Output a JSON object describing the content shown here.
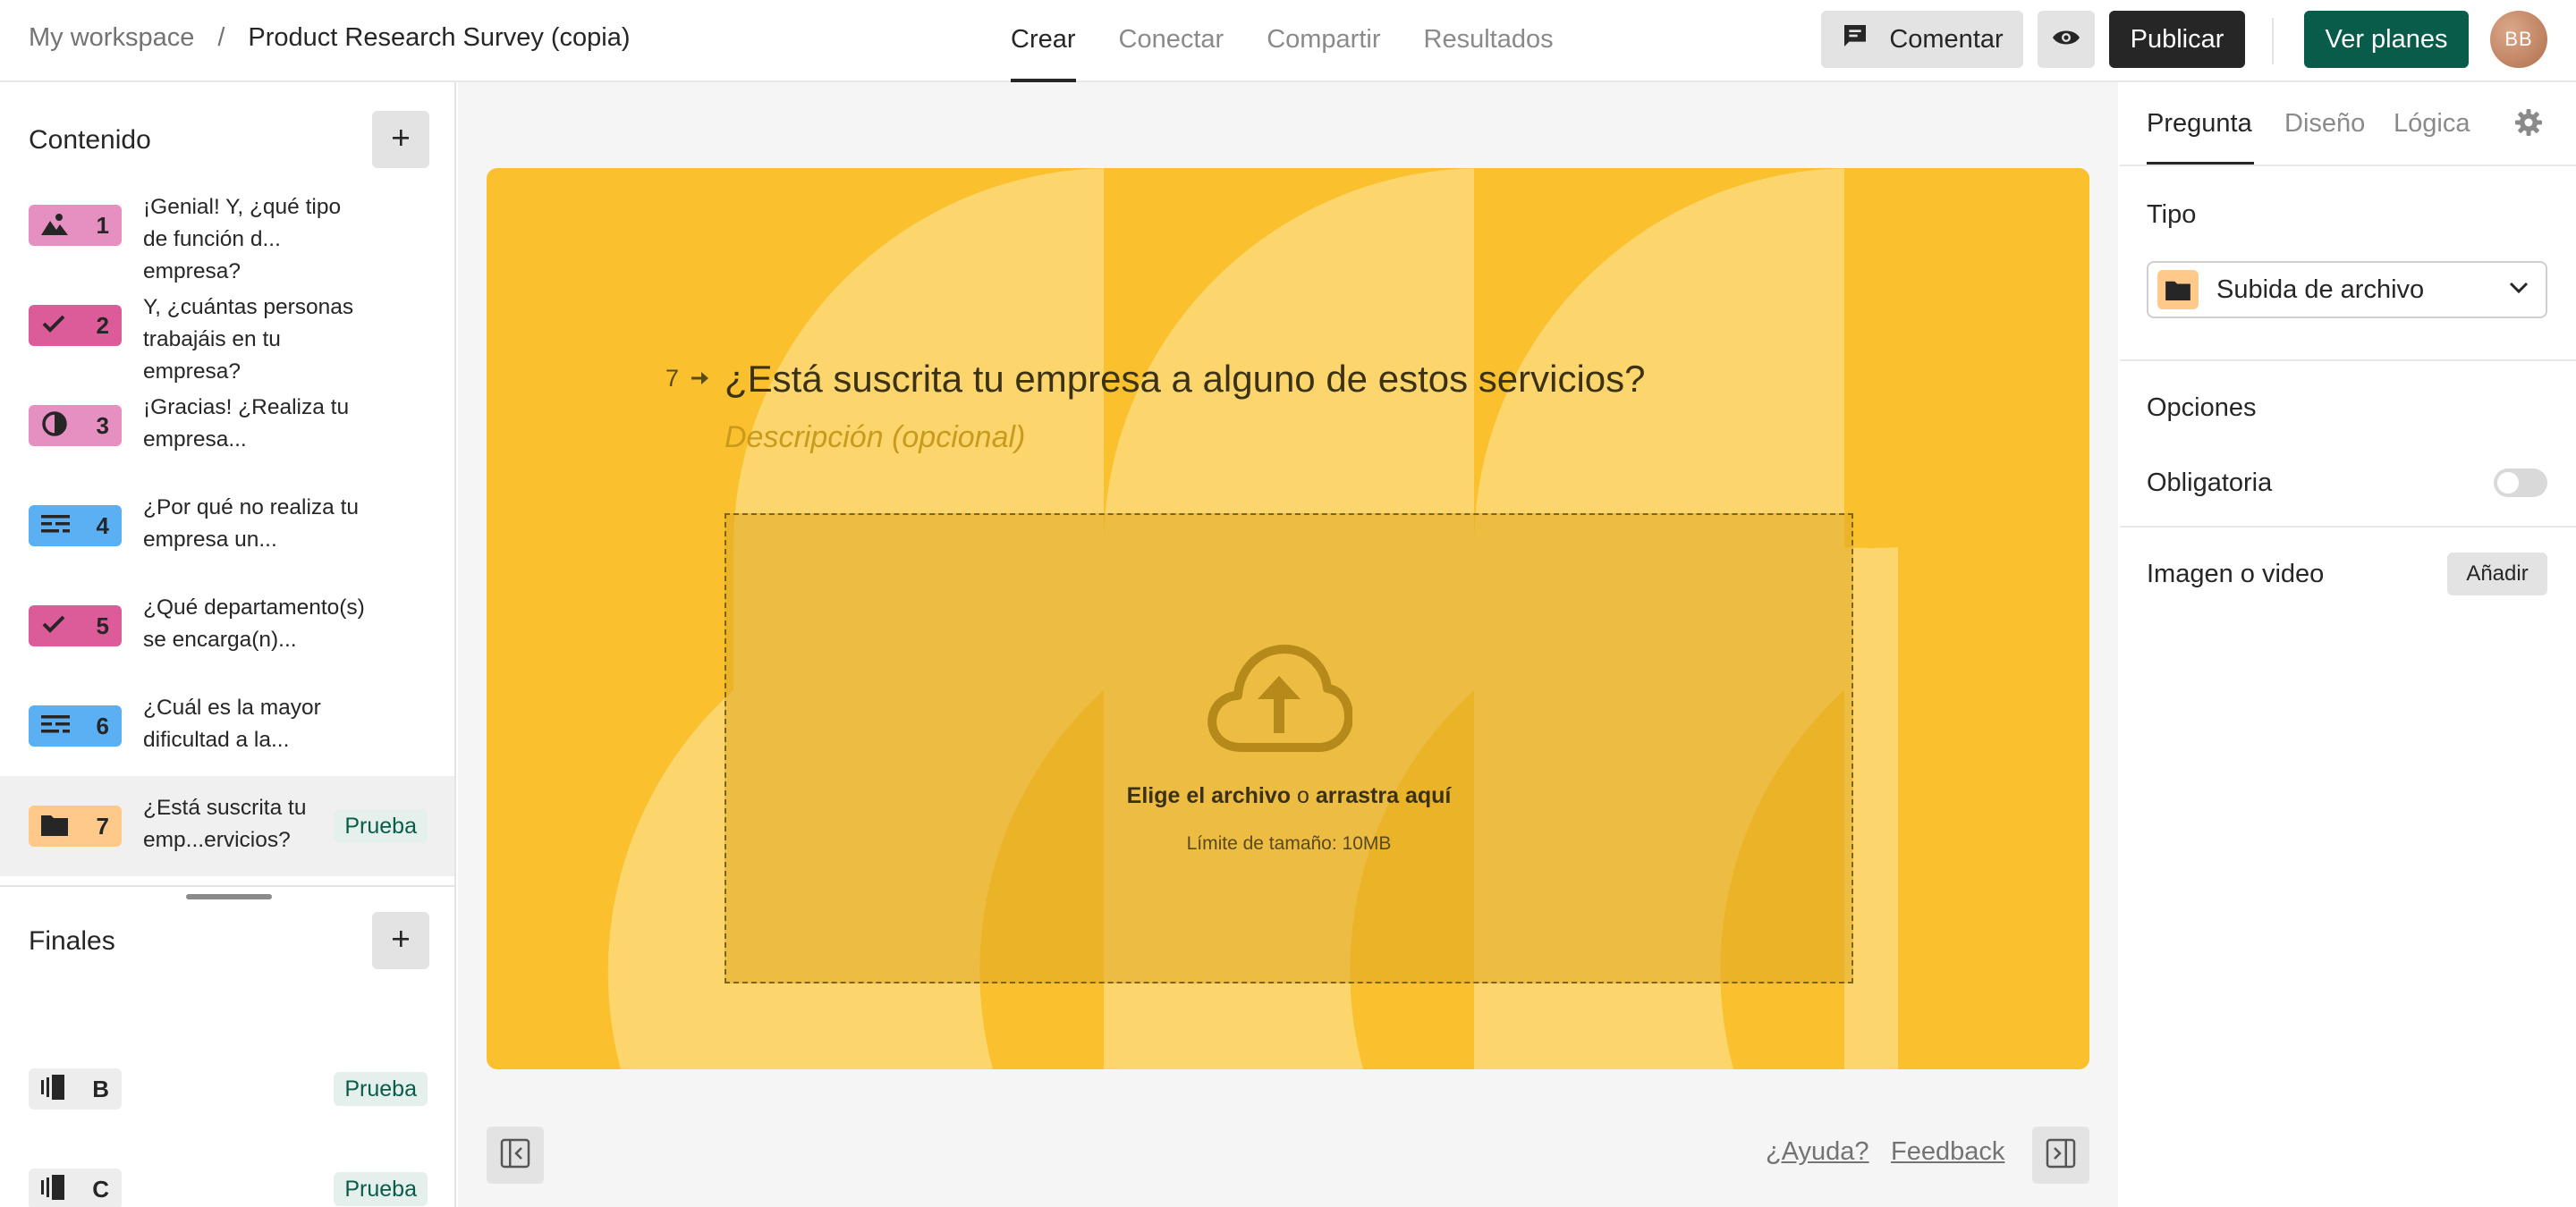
{
  "header": {
    "workspace": "My workspace",
    "separator": "/",
    "form_title": "Product Research Survey (copia)",
    "tabs": [
      {
        "label": "Crear",
        "active": true
      },
      {
        "label": "Conectar",
        "active": false
      },
      {
        "label": "Compartir",
        "active": false
      },
      {
        "label": "Resultados",
        "active": false
      }
    ],
    "comment_label": "Comentar",
    "publish_label": "Publicar",
    "plans_label": "Ver planes",
    "avatar_initials": "BB"
  },
  "sidebar": {
    "content_title": "Contenido",
    "questions": [
      {
        "number": "1",
        "text": "¡Genial! Y, ¿qué tipo de función d... empresa?",
        "icon": "image-icon",
        "color": "#e68fc1"
      },
      {
        "number": "2",
        "text": "Y, ¿cuántas personas trabajáis en tu empresa?",
        "icon": "check-icon",
        "color": "#db5c99"
      },
      {
        "number": "3",
        "text": "¡Gracias! ¿Realiza tu empresa...",
        "icon": "opinion-scale-icon",
        "color": "#e68fc1"
      },
      {
        "number": "4",
        "text": "¿Por qué no realiza tu empresa un...",
        "icon": "long-text-icon",
        "color": "#5ab0f2"
      },
      {
        "number": "5",
        "text": "¿Qué departamento(s) se encarga(n)...",
        "icon": "check-icon",
        "color": "#db5c99"
      },
      {
        "number": "6",
        "text": "¿Cuál es la mayor dificultad a la...",
        "icon": "long-text-icon",
        "color": "#5ab0f2"
      },
      {
        "number": "7",
        "text": "¿Está suscrita tu emp...ervicios?",
        "icon": "folder-icon",
        "color": "#ffc98a",
        "tag": "Prueba",
        "selected": true
      }
    ],
    "endings_title": "Finales",
    "endings": [
      {
        "letter": "B",
        "tag": "Prueba"
      },
      {
        "letter": "C",
        "tag": "Prueba"
      }
    ]
  },
  "canvas": {
    "question_number": "7",
    "question_title": "¿Está suscrita tu empresa a alguno de estos servicios?",
    "description_placeholder": "Descripción (opcional)",
    "upload_choose": "Elige el archivo",
    "upload_or": "o",
    "upload_drag": "arrastra aquí",
    "upload_limit": "Límite de tamaño: 10MB",
    "help_link": "¿Ayuda?",
    "feedback_link": "Feedback",
    "card_color": "#fbc02d"
  },
  "right_panel": {
    "tabs": [
      {
        "label": "Pregunta",
        "active": true
      },
      {
        "label": "Diseño",
        "active": false
      },
      {
        "label": "Lógica",
        "active": false
      }
    ],
    "type_label": "Tipo",
    "type_value": "Subida de archivo",
    "options_label": "Opciones",
    "required_label": "Obligatoria",
    "required_on": false,
    "media_label": "Imagen o video",
    "add_label": "Añadir"
  }
}
